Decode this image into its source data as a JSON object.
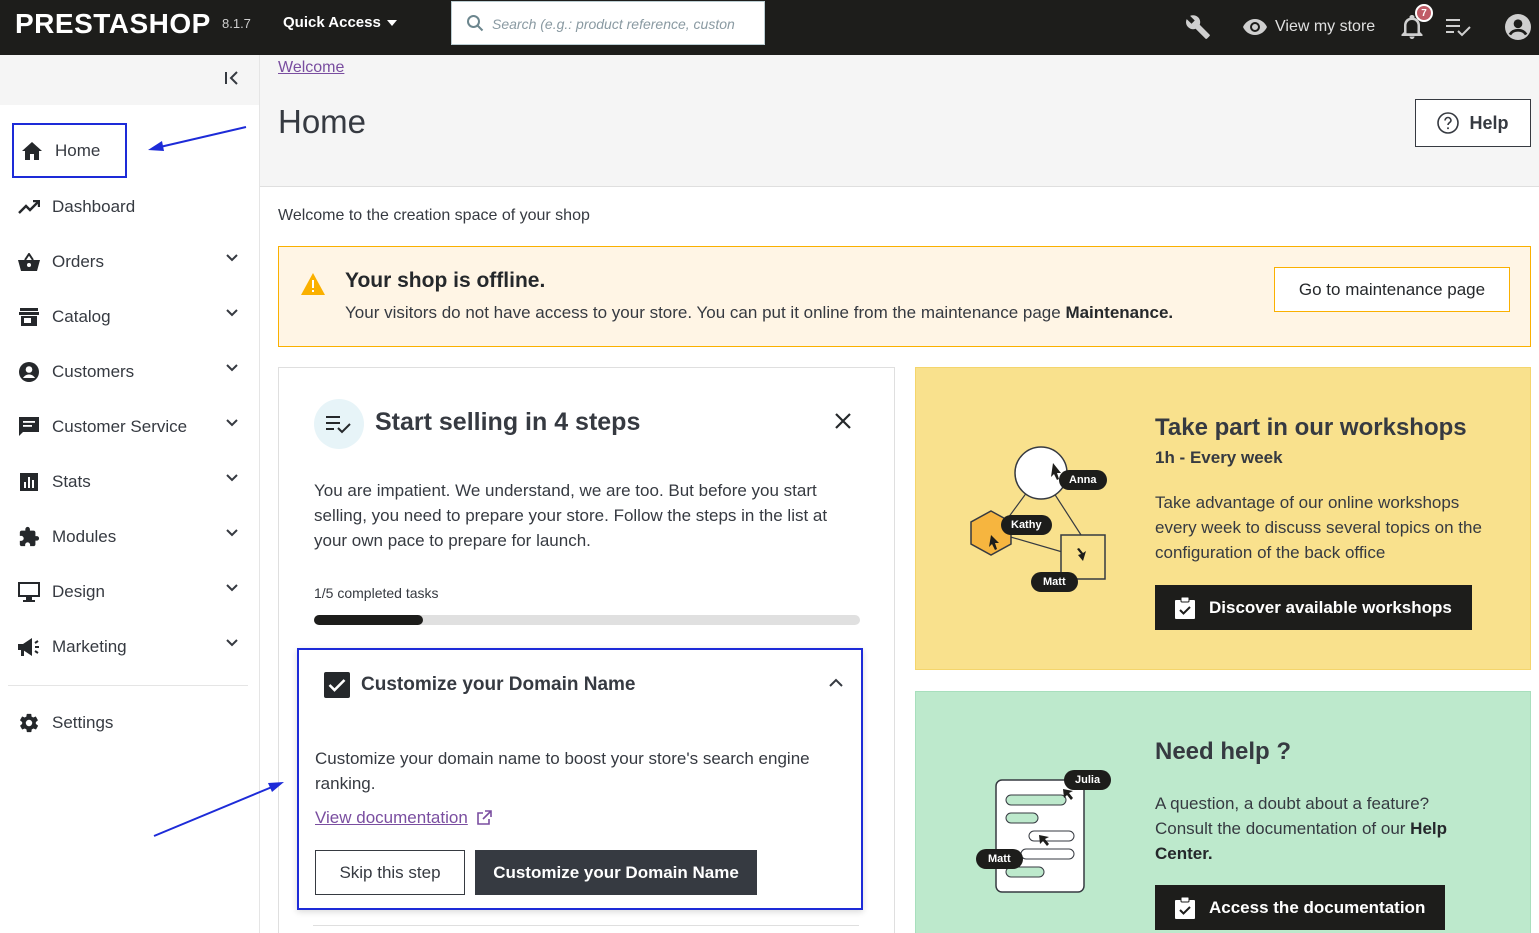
{
  "topbar": {
    "logo": "PRESTASHOP",
    "version": "8.1.7",
    "quick_access": "Quick Access",
    "search_placeholder": "Search (e.g.: product reference, custon",
    "view_store": "View my store",
    "notification_count": "7"
  },
  "sidebar": {
    "items": [
      {
        "label": "Home"
      },
      {
        "label": "Dashboard"
      },
      {
        "label": "Orders"
      },
      {
        "label": "Catalog"
      },
      {
        "label": "Customers"
      },
      {
        "label": "Customer Service"
      },
      {
        "label": "Stats"
      },
      {
        "label": "Modules"
      },
      {
        "label": "Design"
      },
      {
        "label": "Marketing"
      },
      {
        "label": "Settings"
      }
    ]
  },
  "header": {
    "breadcrumb": "Welcome",
    "title": "Home",
    "help_label": "Help"
  },
  "welcome_text": "Welcome to the creation space of your shop",
  "alert": {
    "title": "Your shop is offline.",
    "text": "Your visitors do not have access to your store. You can put it online from the maintenance page",
    "text_bold": "Maintenance.",
    "button": "Go to maintenance page"
  },
  "steps": {
    "title": "Start selling in 4 steps",
    "intro": "You are impatient. We understand, we are too. But before you start selling, you need to prepare your store. Follow the steps in the list at your own pace to prepare for launch.",
    "progress_label": "1/5 completed tasks",
    "progress_fraction": 0.2,
    "task": {
      "title": "Customize your Domain Name",
      "description": "Customize your domain name to boost your store's search engine ranking.",
      "doc_link": "View documentation",
      "skip_button": "Skip this step",
      "action_button": "Customize your Domain Name"
    }
  },
  "workshop_card": {
    "title": "Take part in our workshops",
    "subtitle": "1h - Every week",
    "body": "Take advantage of our online workshops every week to discuss several topics on the configuration of the back office",
    "button": "Discover available workshops",
    "names": [
      "Anna",
      "Kathy",
      "Matt"
    ]
  },
  "help_card": {
    "title": "Need help ?",
    "body": "A question, a doubt about a feature? Consult the documentation of our",
    "body_bold": "Help Center.",
    "button": "Access the documentation",
    "names": [
      "Julia",
      "Matt"
    ]
  },
  "colors": {
    "topbar": "#1d1d1b",
    "annotation_blue": "#1d2bd8",
    "alert_bg": "#fff5e5",
    "alert_border": "#fab000",
    "workshop_bg": "#f9e18d",
    "help_bg": "#bde9cc",
    "link_purple": "#7a4ea0"
  }
}
